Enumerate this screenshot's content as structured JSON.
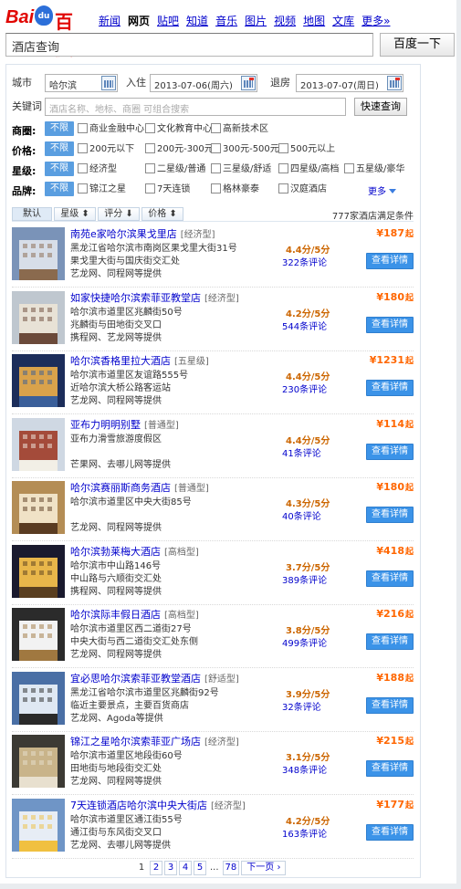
{
  "brand": {
    "left": "Bai",
    "paw": "du",
    "right": "百度"
  },
  "topnav": [
    {
      "label": "新闻",
      "active": false
    },
    {
      "label": "网页",
      "active": true
    },
    {
      "label": "贴吧",
      "active": false
    },
    {
      "label": "知道",
      "active": false
    },
    {
      "label": "音乐",
      "active": false
    },
    {
      "label": "图片",
      "active": false
    },
    {
      "label": "视频",
      "active": false
    },
    {
      "label": "地图",
      "active": false
    },
    {
      "label": "文库",
      "active": false
    },
    {
      "label": "更多»",
      "active": false
    }
  ],
  "search": {
    "query": "酒店查询",
    "button": "百度一下"
  },
  "form": {
    "city_label": "城市",
    "city_value": "哈尔滨",
    "checkin_label": "入住",
    "checkin_value": "2013-07-06(周六)",
    "checkout_label": "退房",
    "checkout_value": "2013-07-07(周日)",
    "keyword_label": "关键词",
    "keyword_placeholder": "酒店名称、地标、商圈 可组合搜索",
    "quick_button": "快速查询"
  },
  "filters": {
    "area": {
      "label": "商圈:",
      "all": "不限",
      "options": [
        "商业金融中心",
        "文化教育中心",
        "高新技术区"
      ]
    },
    "price": {
      "label": "价格:",
      "all": "不限",
      "options": [
        "200元以下",
        "200元-300元",
        "300元-500元",
        "500元以上"
      ]
    },
    "star": {
      "label": "星级:",
      "all": "不限",
      "options": [
        "经济型",
        "二星级/普通",
        "三星级/舒适",
        "四星级/高档",
        "五星级/豪华"
      ]
    },
    "brand": {
      "label": "品牌:",
      "all": "不限",
      "options": [
        "锦江之星",
        "7天连锁",
        "格林豪泰",
        "汉庭酒店"
      ],
      "more": "更多"
    }
  },
  "sort": {
    "default": "默认",
    "star": "星级 ⬍",
    "score": "评分 ⬇",
    "price": "价格 ⬍",
    "count_prefix": "777",
    "count_suffix": "家酒店满足条件"
  },
  "hotels": [
    {
      "name": "南苑e家哈尔滨果戈里店",
      "type": "[经济型]",
      "addr": "黑龙江省哈尔滨市南岗区果戈里大街31号",
      "near": "果戈里大街与国庆街交汇处",
      "src": "艺龙网、同程网等提供",
      "score": "4.4分/5分",
      "reviews": "322条评论",
      "price": "¥187",
      "unit": "起",
      "detail": "查看详情"
    },
    {
      "name": "如家快捷哈尔滨索菲亚教堂店",
      "type": "[经济型]",
      "addr": "哈尔滨市道里区兆麟街50号",
      "near": "兆麟街与田地街交叉口",
      "src": "携程网、艺龙网等提供",
      "score": "4.2分/5分",
      "reviews": "544条评论",
      "price": "¥180",
      "unit": "起",
      "detail": "查看详情"
    },
    {
      "name": "哈尔滨香格里拉大酒店",
      "type": "[五星级]",
      "addr": "哈尔滨市道里区友谊路555号",
      "near": "近哈尔滨大桥公路客运站",
      "src": "艺龙网、同程网等提供",
      "score": "4.4分/5分",
      "reviews": "230条评论",
      "price": "¥1231",
      "unit": "起",
      "detail": "查看详情"
    },
    {
      "name": "亚布力明明别墅",
      "type": "[普通型]",
      "addr": "亚布力滑雪旅游度假区",
      "near": "",
      "src": "芒果网、去哪儿网等提供",
      "score": "4.4分/5分",
      "reviews": "41条评论",
      "price": "¥114",
      "unit": "起",
      "detail": "查看详情"
    },
    {
      "name": "哈尔滨赛丽斯商务酒店",
      "type": "[普通型]",
      "addr": "哈尔滨市道里区中央大街85号",
      "near": "",
      "src": "艺龙网、同程网等提供",
      "score": "4.3分/5分",
      "reviews": "40条评论",
      "price": "¥180",
      "unit": "起",
      "detail": "查看详情"
    },
    {
      "name": "哈尔滨勃莱梅大酒店",
      "type": "[高档型]",
      "addr": "哈尔滨市中山路146号",
      "near": "中山路与六顺街交汇处",
      "src": "携程网、同程网等提供",
      "score": "3.7分/5分",
      "reviews": "389条评论",
      "price": "¥418",
      "unit": "起",
      "detail": "查看详情"
    },
    {
      "name": "哈尔滨际丰假日酒店",
      "type": "[高档型]",
      "addr": "哈尔滨市道里区西二道街27号",
      "near": "中央大街与西二道街交汇处东侧",
      "src": "艺龙网、同程网等提供",
      "score": "3.8分/5分",
      "reviews": "499条评论",
      "price": "¥216",
      "unit": "起",
      "detail": "查看详情"
    },
    {
      "name": "宜必思哈尔滨索菲亚教堂酒店",
      "type": "[舒适型]",
      "addr": "黑龙江省哈尔滨市道里区兆麟街92号",
      "near": "临近主要景点，主要百货商店",
      "src": "艺龙网、Agoda等提供",
      "score": "3.9分/5分",
      "reviews": "32条评论",
      "price": "¥188",
      "unit": "起",
      "detail": "查看详情"
    },
    {
      "name": "锦江之星哈尔滨索菲亚广场店",
      "type": "[经济型]",
      "addr": "哈尔滨市道里区地段街60号",
      "near": "田地街与地段街交汇处",
      "src": "艺龙网、同程网等提供",
      "score": "3.1分/5分",
      "reviews": "348条评论",
      "price": "¥215",
      "unit": "起",
      "detail": "查看详情"
    },
    {
      "name": "7天连锁酒店哈尔滨中央大街店",
      "type": "[经济型]",
      "addr": "哈尔滨市道里区通江街55号",
      "near": "通江街与东风街交叉口",
      "src": "艺龙网、去哪儿网等提供",
      "score": "4.2分/5分",
      "reviews": "163条评论",
      "price": "¥177",
      "unit": "起",
      "detail": "查看详情"
    }
  ],
  "pager": {
    "pages": [
      "1",
      "2",
      "3",
      "4",
      "5"
    ],
    "dots": "...",
    "last": "78",
    "next": "下一页 ›"
  },
  "colors": {
    "link": "#0000cc",
    "price": "#ff6600",
    "button": "#3b93e8",
    "brand_red": "#e10602",
    "brand_blue": "#2c6fd9"
  }
}
